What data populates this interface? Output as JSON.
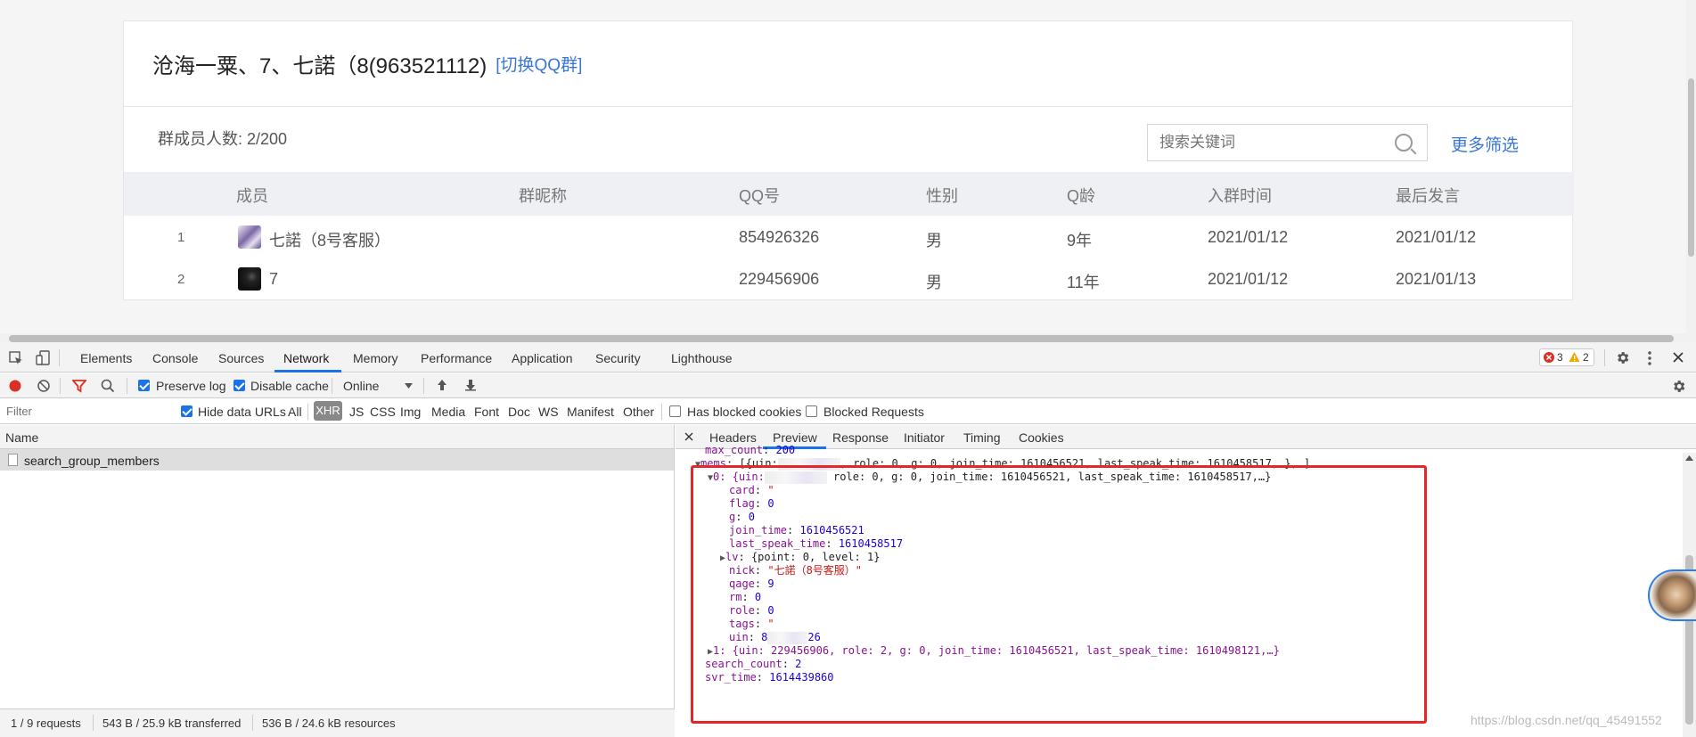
{
  "web": {
    "group_title": "沧海一粟、7、七諾（8(963521112)",
    "switch_link": "[切换QQ群]",
    "member_count": "群成员人数: 2/200",
    "search_placeholder": "搜索关键词",
    "more_filter": "更多筛选",
    "columns": [
      "成员",
      "群昵称",
      "QQ号",
      "性别",
      "Q龄",
      "入群时间",
      "最后发言"
    ],
    "rows": [
      {
        "index": "1",
        "member": "七諾（8号客服）",
        "nick": "",
        "qq": "854926326",
        "gender": "男",
        "qage": "9年",
        "join": "2021/01/12",
        "last": "2021/01/12"
      },
      {
        "index": "2",
        "member": "7",
        "nick": "",
        "qq": "229456906",
        "gender": "男",
        "qage": "11年",
        "join": "2021/01/12",
        "last": "2021/01/13"
      }
    ]
  },
  "devtools": {
    "tabs": [
      "Elements",
      "Console",
      "Sources",
      "Network",
      "Memory",
      "Performance",
      "Application",
      "Security",
      "Lighthouse"
    ],
    "active_tab": "Network",
    "errors": "3",
    "warnings": "2",
    "toolbar": {
      "preserve_log": "Preserve log",
      "disable_cache": "Disable cache",
      "throttle": "Online"
    },
    "filter": {
      "placeholder": "Filter",
      "hide_data_urls": "Hide data URLs",
      "types": [
        "All",
        "XHR",
        "JS",
        "CSS",
        "Img",
        "Media",
        "Font",
        "Doc",
        "WS",
        "Manifest",
        "Other"
      ],
      "has_blocked_cookies": "Has blocked cookies",
      "blocked_requests": "Blocked Requests"
    },
    "name_header": "Name",
    "request_name": "search_group_members",
    "status": {
      "requests": "1 / 9 requests",
      "transferred": "543 B / 25.9 kB transferred",
      "resources": "536 B / 24.6 kB resources"
    },
    "detail_tabs": [
      "Headers",
      "Preview",
      "Response",
      "Initiator",
      "Timing",
      "Cookies"
    ],
    "active_detail_tab": "Preview",
    "preview": {
      "max_count_key": "max_count",
      "max_count_val": "200",
      "mems_key": "mems",
      "mems_summary_a": "[{uin:",
      "mems_summary_b": ", role: 0, g: 0, join_time: 1610456521, last_speak_time: 1610458517,…},…]",
      "item0_a": "0: {uin:",
      "item0_b": " role: 0, g: 0, join_time: 1610456521, last_speak_time: 1610458517,…}",
      "card_key": "card",
      "card_val": "\"",
      "flag_key": "flag",
      "flag_val": "0",
      "g_key": "g",
      "g_val": "0",
      "join_time_key": "join_time",
      "join_time_val": "1610456521",
      "last_speak_time_key": "last_speak_time",
      "last_speak_time_val": "1610458517",
      "lv_key": "lv",
      "lv_val": "{point: 0, level: 1}",
      "nick_key": "nick",
      "nick_val": "\"七諾（8号客服）\"",
      "qage_key": "qage",
      "qage_val": "9",
      "rm_key": "rm",
      "rm_val": "0",
      "role_key": "role",
      "role_val": "0",
      "tags_key": "tags",
      "tags_val": "\"",
      "uin_key": "uin",
      "uin_val_a": "8",
      "uin_val_b": "26",
      "item1": "1: {uin: 229456906, role: 2, g: 0, join_time: 1610456521, last_speak_time: 1610498121,…}",
      "search_count_key": "search_count",
      "search_count_val": "2",
      "svr_time_key": "svr_time",
      "svr_time_val": "1614439860"
    },
    "watermark": "https://blog.csdn.net/qq_45491552"
  },
  "colors": {
    "accent": "#1a73e8",
    "link": "#3b76d6",
    "highlight_box": "#e5262a"
  }
}
